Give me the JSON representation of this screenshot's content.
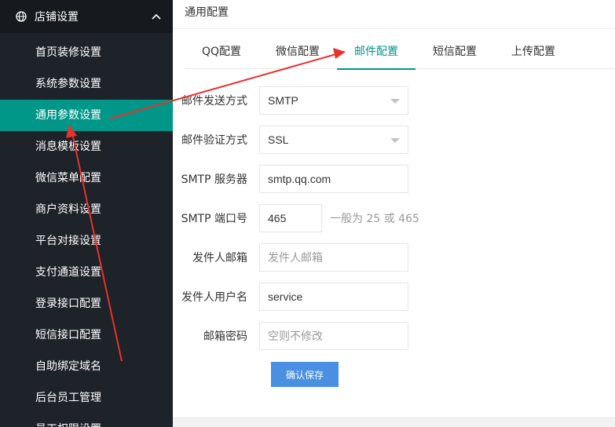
{
  "sidebar": {
    "header_title": "店铺设置",
    "items": [
      {
        "label": "首页装修设置"
      },
      {
        "label": "系统参数设置"
      },
      {
        "label": "通用参数设置",
        "active": true
      },
      {
        "label": "消息模板设置"
      },
      {
        "label": "微信菜单配置"
      },
      {
        "label": "商户资料设置"
      },
      {
        "label": "平台对接设置"
      },
      {
        "label": "支付通道设置"
      },
      {
        "label": "登录接口配置"
      },
      {
        "label": "短信接口配置"
      },
      {
        "label": "自助绑定域名"
      },
      {
        "label": "后台员工管理"
      },
      {
        "label": "员工权限设置"
      }
    ]
  },
  "header": {
    "title": "通用配置"
  },
  "tabs": [
    {
      "label": "QQ配置"
    },
    {
      "label": "微信配置"
    },
    {
      "label": "邮件配置",
      "active": true
    },
    {
      "label": "短信配置"
    },
    {
      "label": "上传配置"
    }
  ],
  "form": {
    "send_method": {
      "label": "邮件发送方式",
      "value": "SMTP"
    },
    "verify_method": {
      "label": "邮件验证方式",
      "value": "SSL"
    },
    "smtp_server": {
      "label": "SMTP 服务器",
      "value": "smtp.qq.com"
    },
    "smtp_port": {
      "label": "SMTP 端口号",
      "value": "465",
      "hint": "一般为 25 或 465"
    },
    "sender_email": {
      "label": "发件人邮箱",
      "placeholder": "发件人邮箱"
    },
    "sender_username": {
      "label": "发件人用户名",
      "value": "service"
    },
    "email_password": {
      "label": "邮箱密码",
      "placeholder": "空则不修改"
    },
    "save_label": "确认保存"
  },
  "colors": {
    "sidebar_bg": "#1e2229",
    "active_accent": "#009688",
    "button_blue": "#4a90e2",
    "annotation_red": "#e8322c"
  }
}
